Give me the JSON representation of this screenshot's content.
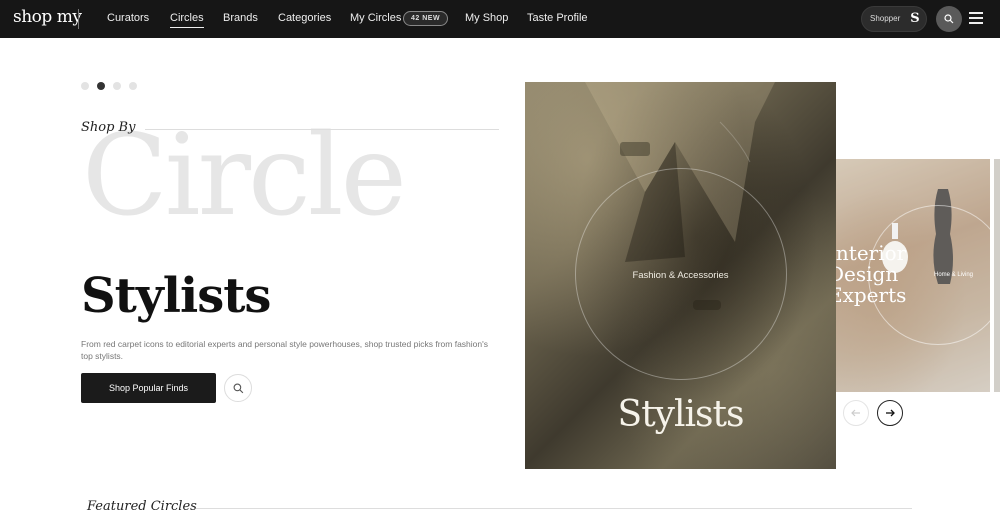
{
  "nav": {
    "logo": "shop my",
    "links": [
      {
        "label": "Curators",
        "active": false
      },
      {
        "label": "Circles",
        "active": true
      },
      {
        "label": "Brands",
        "active": false
      },
      {
        "label": "Categories",
        "active": false
      },
      {
        "label": "My Circles",
        "active": false
      },
      {
        "label": "My Shop",
        "active": false
      },
      {
        "label": "Taste Profile",
        "active": false
      }
    ],
    "my_circles_badge": "42 NEW",
    "shopper_label": "Shopper",
    "shopper_avatar": "S",
    "icons": {
      "search": "search-icon",
      "menu": "hamburger-menu-icon"
    }
  },
  "hero": {
    "carousel_dots": 4,
    "active_dot": 1,
    "eyebrow": "Shop By",
    "watermark": "Circle",
    "title": "Stylists",
    "description": "From red carpet icons to editorial experts and personal style powerhouses, shop trusted picks from fashion's top stylists.",
    "cta_label": "Shop Popular Finds",
    "cards": [
      {
        "category": "Fashion & Accessories",
        "title": "Stylists"
      },
      {
        "category": "Home & Living",
        "title": "Interior\nDesign\nExperts"
      }
    ],
    "arrows": {
      "prev": "arrow-left-icon",
      "next": "arrow-right-icon"
    }
  },
  "featured": {
    "heading": "Featured Circles"
  },
  "colors": {
    "nav_bg": "#161616",
    "cta_bg": "#1b1b1b",
    "watermark": "#e6e6e6"
  }
}
